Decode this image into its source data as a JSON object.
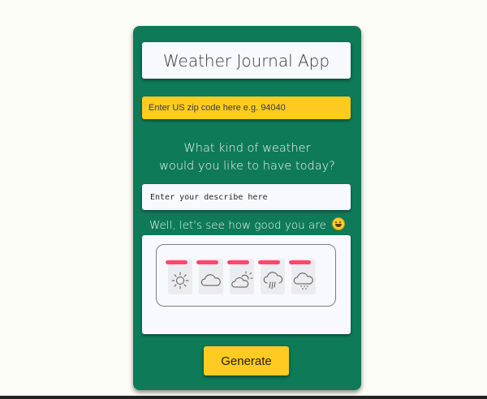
{
  "app": {
    "title": "Weather Journal App"
  },
  "zip": {
    "placeholder": "Enter US zip code here e.g. 94040",
    "value": ""
  },
  "question": {
    "line1": "What kind of weather",
    "line2": "would you like to have today?"
  },
  "describe": {
    "placeholder": "Enter your describe here",
    "value": ""
  },
  "guess": {
    "label": "Well, let's see how good you are",
    "emoji_icon": "grinning-sweat-emoji-icon"
  },
  "weather_options": [
    {
      "icon": "sun-icon"
    },
    {
      "icon": "cloud-icon"
    },
    {
      "icon": "partly-cloudy-icon"
    },
    {
      "icon": "rain-cloud-icon"
    },
    {
      "icon": "drizzle-cloud-icon"
    }
  ],
  "generate": {
    "label": "Generate"
  },
  "colors": {
    "page_background": "#fdfdf7",
    "card_background": "#0e7a58",
    "accent_yellow": "#ffcb21",
    "panel_background": "#f8f8ff",
    "option_marker": "#ff4767"
  }
}
